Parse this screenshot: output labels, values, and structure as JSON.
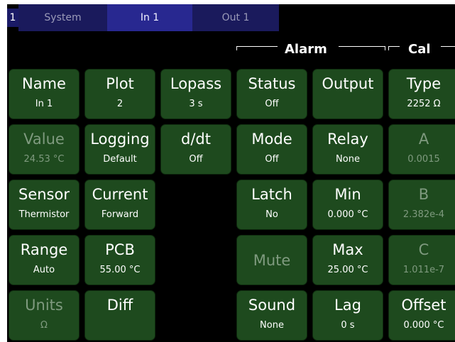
{
  "tabs": {
    "number": "1",
    "items": [
      {
        "label": "System"
      },
      {
        "label": "In 1"
      },
      {
        "label": "Out 1"
      }
    ]
  },
  "groups": {
    "alarm": "Alarm",
    "cal": "Cal"
  },
  "cells": {
    "name": {
      "title": "Name",
      "value": "In 1"
    },
    "plot": {
      "title": "Plot",
      "value": "2"
    },
    "lopass": {
      "title": "Lopass",
      "value": "3 s"
    },
    "status": {
      "title": "Status",
      "value": "Off"
    },
    "output": {
      "title": "Output",
      "value": ""
    },
    "type": {
      "title": "Type",
      "value": "2252 Ω"
    },
    "value": {
      "title": "Value",
      "value": "24.53 °C"
    },
    "logging": {
      "title": "Logging",
      "value": "Default"
    },
    "ddt": {
      "title": "d/dt",
      "value": "Off"
    },
    "mode": {
      "title": "Mode",
      "value": "Off"
    },
    "relay": {
      "title": "Relay",
      "value": "None"
    },
    "a": {
      "title": "A",
      "value": "0.0015"
    },
    "sensor": {
      "title": "Sensor",
      "value": "Thermistor"
    },
    "current": {
      "title": "Current",
      "value": "Forward"
    },
    "latch": {
      "title": "Latch",
      "value": "No"
    },
    "min": {
      "title": "Min",
      "value": "0.000 °C"
    },
    "b": {
      "title": "B",
      "value": "2.382e-4"
    },
    "range": {
      "title": "Range",
      "value": "Auto"
    },
    "pcb": {
      "title": "PCB",
      "value": "55.00 °C"
    },
    "mute": {
      "title": "Mute",
      "value": ""
    },
    "max": {
      "title": "Max",
      "value": "25.00 °C"
    },
    "c": {
      "title": "C",
      "value": "1.011e-7"
    },
    "units": {
      "title": "Units",
      "value": "Ω"
    },
    "diff": {
      "title": "Diff",
      "value": ""
    },
    "sound": {
      "title": "Sound",
      "value": "None"
    },
    "lag": {
      "title": "Lag",
      "value": "0 s"
    },
    "offset": {
      "title": "Offset",
      "value": "0.000 °C"
    }
  },
  "colors": {
    "background": "#000000",
    "cell": "#1e4a1e",
    "tab": "#1a1a5c",
    "tab_active": "#282890",
    "dim_text": "#7f9a7f"
  }
}
